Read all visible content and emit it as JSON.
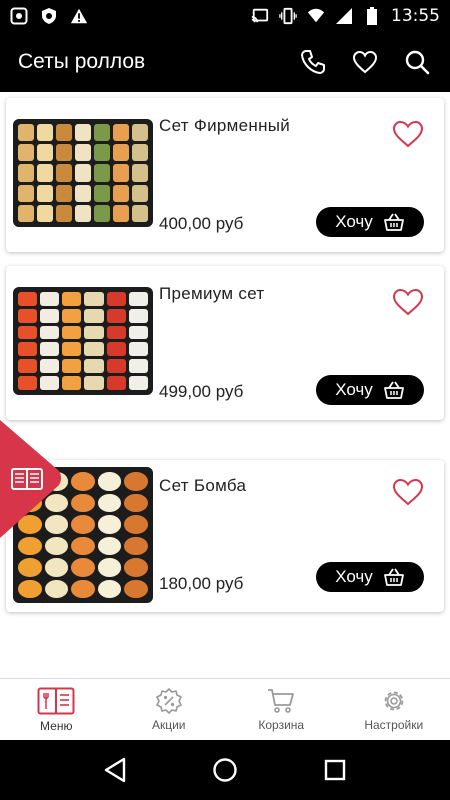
{
  "status_bar": {
    "time": "13:55"
  },
  "app_bar": {
    "title": "Сеты роллов"
  },
  "products": [
    {
      "name": "Сет Фирменный",
      "price": "400,00 руб",
      "button_label": "Хочу"
    },
    {
      "name": "Премиум сет",
      "price": "499,00 руб",
      "button_label": "Хочу"
    },
    {
      "name": "Сет Бомба",
      "price": "180,00 руб",
      "button_label": "Хочу"
    }
  ],
  "bottom_nav": [
    {
      "label": "Меню",
      "icon": "menu-book-icon"
    },
    {
      "label": "Акции",
      "icon": "percent-badge-icon"
    },
    {
      "label": "Корзина",
      "icon": "cart-icon"
    },
    {
      "label": "Настройки",
      "icon": "gear-icon"
    }
  ],
  "colors": {
    "accent": "#d6354a",
    "bar": "#000000",
    "button": "#000000",
    "nav_icon": "#999999"
  }
}
